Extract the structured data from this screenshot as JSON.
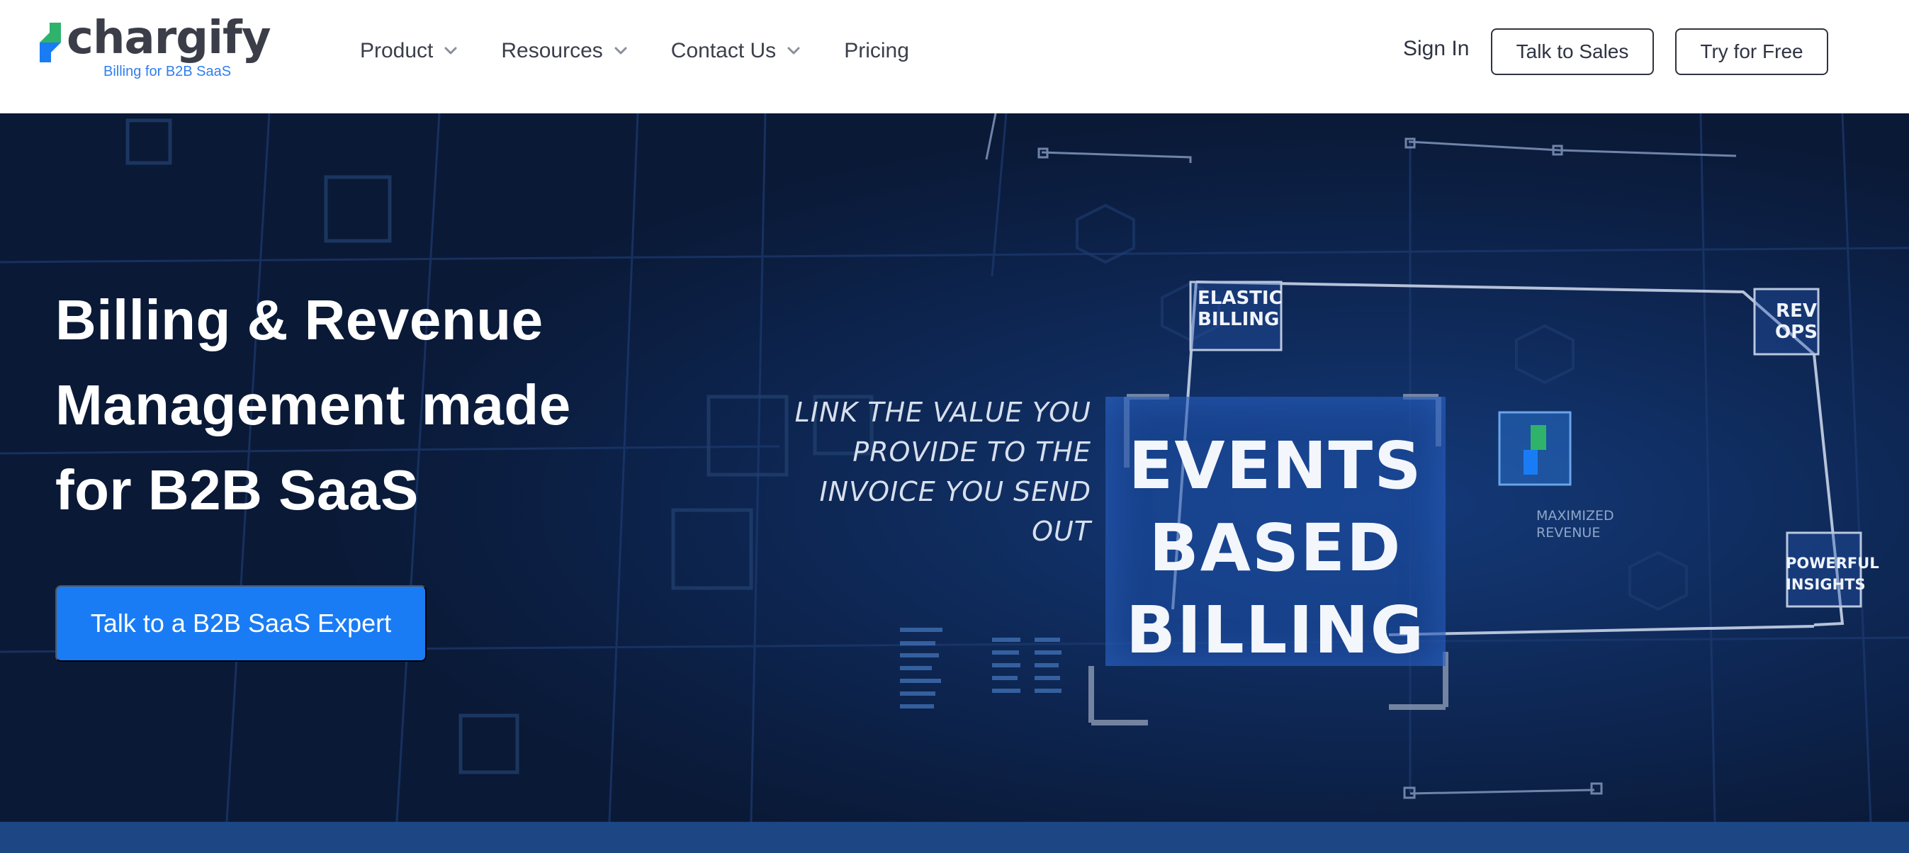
{
  "brand": {
    "name": "chargify",
    "tagline": "Billing for B2B SaaS",
    "colors": {
      "green": "#2fb36b",
      "blue": "#1a7cf4",
      "dark": "#3b3e48"
    }
  },
  "nav": {
    "items": [
      {
        "label": "Product",
        "has_dropdown": true
      },
      {
        "label": "Resources",
        "has_dropdown": true
      },
      {
        "label": "Contact Us",
        "has_dropdown": true
      },
      {
        "label": "Pricing",
        "has_dropdown": false
      }
    ],
    "sign_in": "Sign In",
    "talk_to_sales": "Talk to Sales",
    "try_for_free": "Try for Free"
  },
  "hero": {
    "title": "Billing & Revenue Management made for B2B SaaS",
    "cta": "Talk to a B2B SaaS Expert",
    "background_color": "#0b1b3d",
    "video": {
      "tagline": "LINK THE VALUE YOU PROVIDE TO THE INVOICE YOU SEND OUT",
      "main_label": "EVENTS BASED BILLING",
      "label_elastic": "ELASTIC BILLING",
      "label_revops": "REV OPS",
      "label_insights": "POWERFUL INSIGHTS",
      "label_maximized": "MAXIMIZED REVENUE"
    }
  }
}
